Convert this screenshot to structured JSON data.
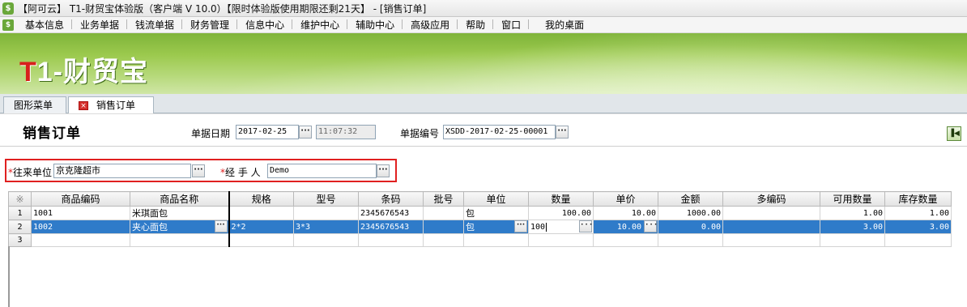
{
  "window": {
    "title": "【阿可云】 T1-财贸宝体验版（客户端 V 10.0）【限时体验版使用期限还剩21天】 - [销售订单]"
  },
  "menu": {
    "items": [
      "基本信息",
      "业务单据",
      "钱流单据",
      "财务管理",
      "信息中心",
      "维护中心",
      "辅助中心",
      "高级应用",
      "帮助",
      "窗口",
      "我的桌面"
    ]
  },
  "banner": {
    "brand_t": "T",
    "brand_rest": "1-财贸宝"
  },
  "tabs": [
    {
      "label": "图形菜单"
    },
    {
      "label": "销售订单",
      "close_icon": "×"
    }
  ],
  "form": {
    "title": "销售订单",
    "date_label": "单据日期",
    "date_value": "2017-02-25",
    "time_value": "11:07:32",
    "number_label": "单据编号",
    "number_value": "XSDD-2017-02-25-00001",
    "partner_label": "往来单位",
    "partner_value": "京克隆超市",
    "handler_label": "经 手 人",
    "handler_value": "Demo",
    "required_mark": "*",
    "dots": "···",
    "nav_icon": "▐◀"
  },
  "grid": {
    "corner": "※",
    "columns": [
      "商品编码",
      "商品名称",
      "规格",
      "型号",
      "条码",
      "批号",
      "单位",
      "数量",
      "单价",
      "金额",
      "多编码",
      "可用数量",
      "库存数量"
    ],
    "rows": [
      {
        "no": "1",
        "code": "1001",
        "name": "米琪面包",
        "spec": "",
        "model": "",
        "barcode": "2345676543",
        "batch": "",
        "unit": "包",
        "qty": "100.00",
        "price": "10.00",
        "amount": "1000.00",
        "multi": "",
        "avail": "1.00",
        "stock": "1.00"
      },
      {
        "no": "2",
        "code": "1002",
        "name": "夹心面包",
        "spec": "2*2",
        "model": "3*3",
        "barcode": "2345676543",
        "batch": "",
        "unit": "包",
        "qty": "100",
        "price": "10.00",
        "amount": "0.00",
        "multi": "",
        "avail": "3.00",
        "stock": "3.00"
      },
      {
        "no": "3",
        "code": "",
        "name": "",
        "spec": "",
        "model": "",
        "barcode": "",
        "batch": "",
        "unit": "",
        "qty": "",
        "price": "",
        "amount": "",
        "multi": "",
        "avail": "",
        "stock": ""
      }
    ]
  }
}
